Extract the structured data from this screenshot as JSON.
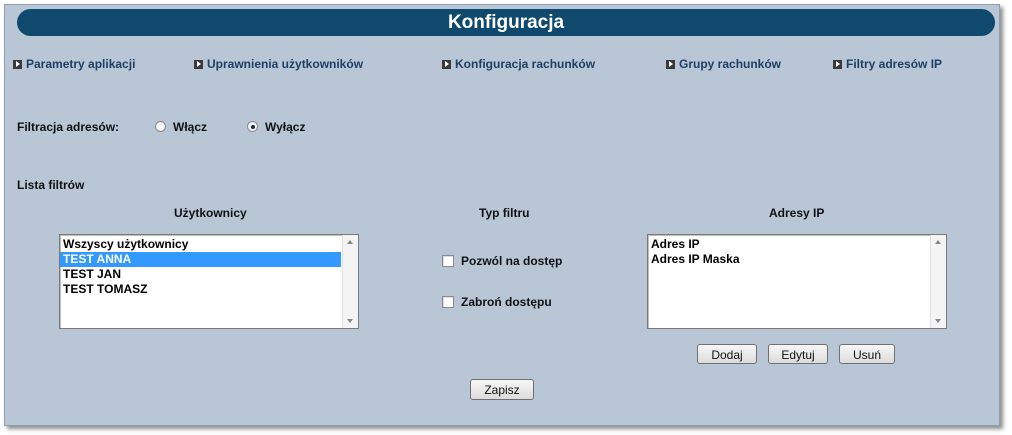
{
  "header": {
    "title": "Konfiguracja"
  },
  "nav": [
    {
      "label": "Parametry aplikacji"
    },
    {
      "label": "Uprawnienia użytkowników"
    },
    {
      "label": "Konfiguracja rachunków"
    },
    {
      "label": "Grupy rachunków"
    },
    {
      "label": "Filtry adresów IP"
    }
  ],
  "filter": {
    "label": "Filtracja adresów:",
    "on_label": "Włącz",
    "off_label": "Wyłącz",
    "selected": "off"
  },
  "filters_list": {
    "title": "Lista filtrów",
    "users": {
      "header": "Użytkownicy",
      "items": [
        "Wszyscy użytkownicy",
        "TEST ANNA",
        "TEST JAN",
        "TEST TOMASZ"
      ],
      "selected_index": 1
    },
    "type": {
      "header": "Typ filtru",
      "allow_label": "Pozwól na dostęp",
      "allow_checked": false,
      "deny_label": "Zabroń dostępu",
      "deny_checked": false
    },
    "ips": {
      "header": "Adresy IP",
      "items": [
        "Adres IP",
        "Adres IP Maska"
      ]
    }
  },
  "buttons": {
    "add": "Dodaj",
    "edit": "Edytuj",
    "delete": "Usuń",
    "save": "Zapisz"
  },
  "colors": {
    "header_bg": "#0f4a6e",
    "panel_bg": "#b8c6d6",
    "nav_text": "#1f3f66",
    "selection": "#3399ff"
  }
}
